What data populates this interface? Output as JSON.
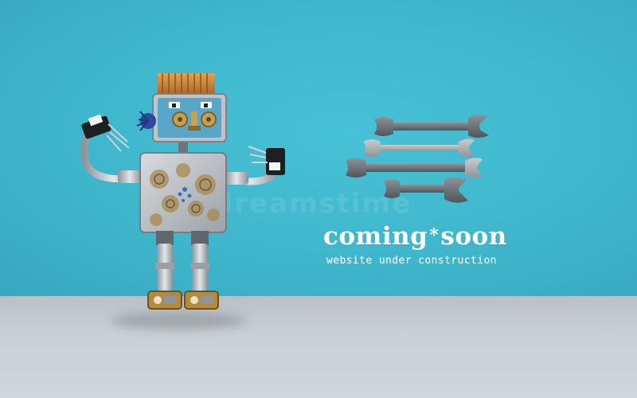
{
  "scene": {
    "headline_left": "coming",
    "headline_star": "*",
    "headline_right": "soon",
    "subline": "website under construction",
    "watermark": "dreamstime",
    "colors": {
      "wall": "#3fb6cc",
      "floor": "#c9cfd4",
      "text": "#ffffff",
      "metal": "#b7bcc2",
      "copper": "#c9853a"
    }
  },
  "objects": {
    "robot": "toy-robot",
    "tools": [
      "wrench-1",
      "wrench-2",
      "wrench-3",
      "wrench-4"
    ]
  }
}
